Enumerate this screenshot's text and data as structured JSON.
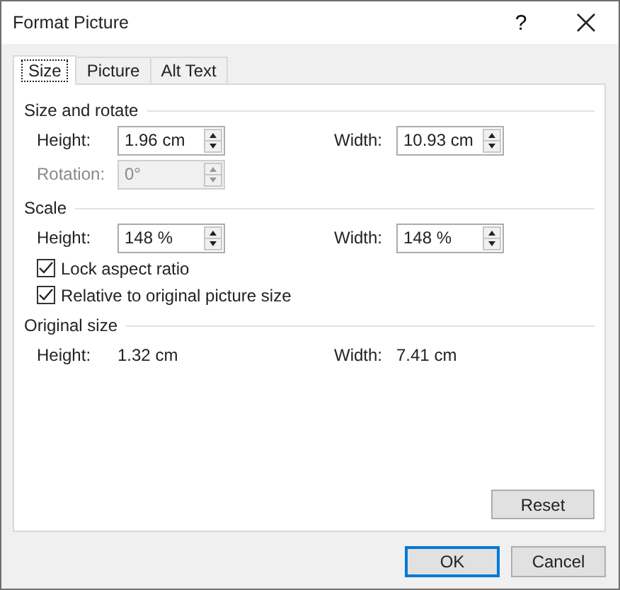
{
  "window": {
    "title": "Format Picture",
    "help": "?"
  },
  "tabs": [
    {
      "label": "Size",
      "selected": true
    },
    {
      "label": "Picture",
      "selected": false
    },
    {
      "label": "Alt Text",
      "selected": false
    }
  ],
  "sections": [
    {
      "title": "Size and rotate",
      "rows": [
        {
          "kind": "fields",
          "fields": [
            {
              "label": "Height:",
              "value": "1.96 cm",
              "disabled": false
            },
            {
              "label": "Width:",
              "value": "10.93 cm",
              "disabled": false
            }
          ]
        },
        {
          "kind": "fields",
          "fields": [
            {
              "label": "Rotation:",
              "value": "0°",
              "disabled": true
            }
          ]
        }
      ]
    },
    {
      "title": "Scale",
      "rows": [
        {
          "kind": "fields",
          "fields": [
            {
              "label": "Height:",
              "value": "148 %",
              "disabled": false
            },
            {
              "label": "Width:",
              "value": "148 %",
              "disabled": false
            }
          ]
        },
        {
          "kind": "checkbox",
          "label": "Lock aspect ratio",
          "checked": true
        },
        {
          "kind": "checkbox",
          "label": "Relative to original picture size",
          "checked": true
        }
      ]
    },
    {
      "title": "Original size",
      "rows": [
        {
          "kind": "info",
          "fields": [
            {
              "label": "Height:",
              "value": "1.32 cm"
            },
            {
              "label": "Width:",
              "value": "7.41 cm"
            }
          ]
        }
      ]
    }
  ],
  "reset_button": "Reset",
  "buttons": [
    {
      "label": "OK",
      "default": true
    },
    {
      "label": "Cancel",
      "default": false
    }
  ]
}
